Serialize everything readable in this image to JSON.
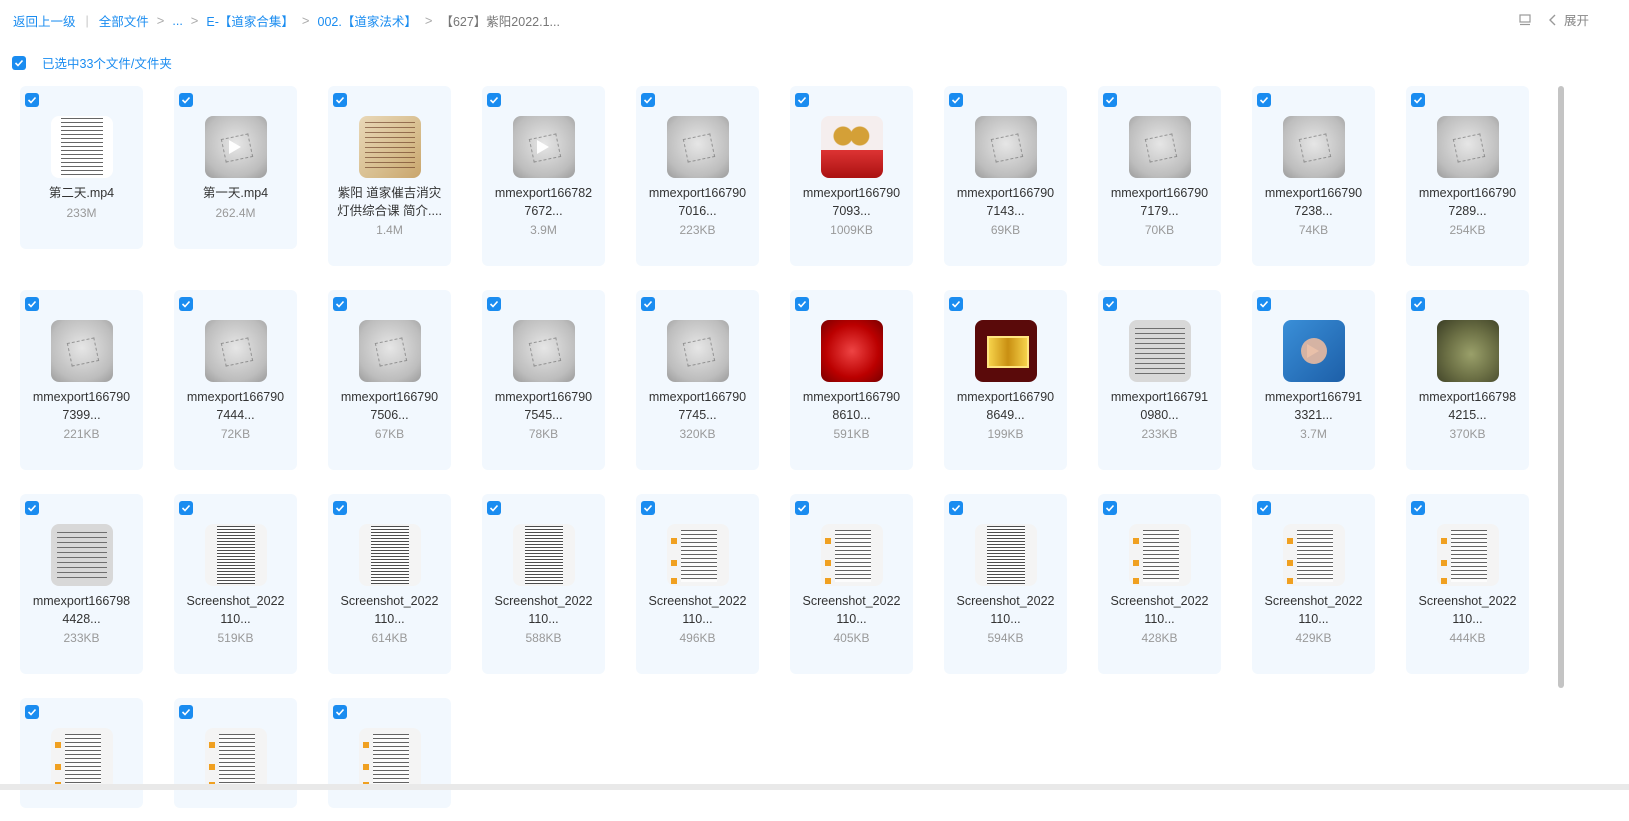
{
  "breadcrumb": {
    "back": "返回上一级",
    "items": [
      "全部文件",
      "...",
      "E-【道家合集】",
      "002.【道家法术】",
      "【627】紫阳2022.1..."
    ]
  },
  "toolbar": {
    "expand_label": "展开"
  },
  "selection": {
    "text": "已选中33个文件/文件夹"
  },
  "colors": {
    "accent": "#1a8cf0",
    "card_bg": "#f2f8fe"
  },
  "files": [
    {
      "name1": "第二天.mp4",
      "name2": "",
      "size": "233M",
      "thumb": "video-doc"
    },
    {
      "name1": "第一天.mp4",
      "name2": "",
      "size": "262.4M",
      "thumb": "video-gray"
    },
    {
      "name1": "紫阳 道家催吉消灾",
      "name2": "灯供综合课 简介....",
      "size": "1.4M",
      "thumb": "parchment"
    },
    {
      "name1": "mmexport166782",
      "name2": "7672...",
      "size": "3.9M",
      "thumb": "video-gray"
    },
    {
      "name1": "mmexport166790",
      "name2": "7016...",
      "size": "223KB",
      "thumb": "gray"
    },
    {
      "name1": "mmexport166790",
      "name2": "7093...",
      "size": "1009KB",
      "thumb": "bells"
    },
    {
      "name1": "mmexport166790",
      "name2": "7143...",
      "size": "69KB",
      "thumb": "gray"
    },
    {
      "name1": "mmexport166790",
      "name2": "7179...",
      "size": "70KB",
      "thumb": "gray"
    },
    {
      "name1": "mmexport166790",
      "name2": "7238...",
      "size": "74KB",
      "thumb": "gray"
    },
    {
      "name1": "mmexport166790",
      "name2": "7289...",
      "size": "254KB",
      "thumb": "gray"
    },
    {
      "name1": "mmexport166790",
      "name2": "7399...",
      "size": "221KB",
      "thumb": "gray"
    },
    {
      "name1": "mmexport166790",
      "name2": "7444...",
      "size": "72KB",
      "thumb": "gray"
    },
    {
      "name1": "mmexport166790",
      "name2": "7506...",
      "size": "67KB",
      "thumb": "gray"
    },
    {
      "name1": "mmexport166790",
      "name2": "7545...",
      "size": "78KB",
      "thumb": "gray"
    },
    {
      "name1": "mmexport166790",
      "name2": "7745...",
      "size": "320KB",
      "thumb": "gray"
    },
    {
      "name1": "mmexport166790",
      "name2": "8610...",
      "size": "591KB",
      "thumb": "red"
    },
    {
      "name1": "mmexport166790",
      "name2": "8649...",
      "size": "199KB",
      "thumb": "gold"
    },
    {
      "name1": "mmexport166791",
      "name2": "0980...",
      "size": "233KB",
      "thumb": "textgray"
    },
    {
      "name1": "mmexport166791",
      "name2": "3321...",
      "size": "3.7M",
      "thumb": "video-hand"
    },
    {
      "name1": "mmexport166798",
      "name2": "4215...",
      "size": "370KB",
      "thumb": "bowl"
    },
    {
      "name1": "mmexport166798",
      "name2": "4428...",
      "size": "233KB",
      "thumb": "textgray"
    },
    {
      "name1": "Screenshot_2022",
      "name2": "110...",
      "size": "519KB",
      "thumb": "shot"
    },
    {
      "name1": "Screenshot_2022",
      "name2": "110...",
      "size": "614KB",
      "thumb": "shot"
    },
    {
      "name1": "Screenshot_2022",
      "name2": "110...",
      "size": "588KB",
      "thumb": "shot"
    },
    {
      "name1": "Screenshot_2022",
      "name2": "110...",
      "size": "496KB",
      "thumb": "chat"
    },
    {
      "name1": "Screenshot_2022",
      "name2": "110...",
      "size": "405KB",
      "thumb": "chat"
    },
    {
      "name1": "Screenshot_2022",
      "name2": "110...",
      "size": "594KB",
      "thumb": "shot"
    },
    {
      "name1": "Screenshot_2022",
      "name2": "110...",
      "size": "428KB",
      "thumb": "chat"
    },
    {
      "name1": "Screenshot_2022",
      "name2": "110...",
      "size": "429KB",
      "thumb": "chat"
    },
    {
      "name1": "Screenshot_2022",
      "name2": "110...",
      "size": "444KB",
      "thumb": "chat"
    },
    {
      "name1": "",
      "name2": "",
      "size": "",
      "thumb": "chat"
    },
    {
      "name1": "",
      "name2": "",
      "size": "",
      "thumb": "chat"
    },
    {
      "name1": "",
      "name2": "",
      "size": "",
      "thumb": "chat"
    }
  ]
}
